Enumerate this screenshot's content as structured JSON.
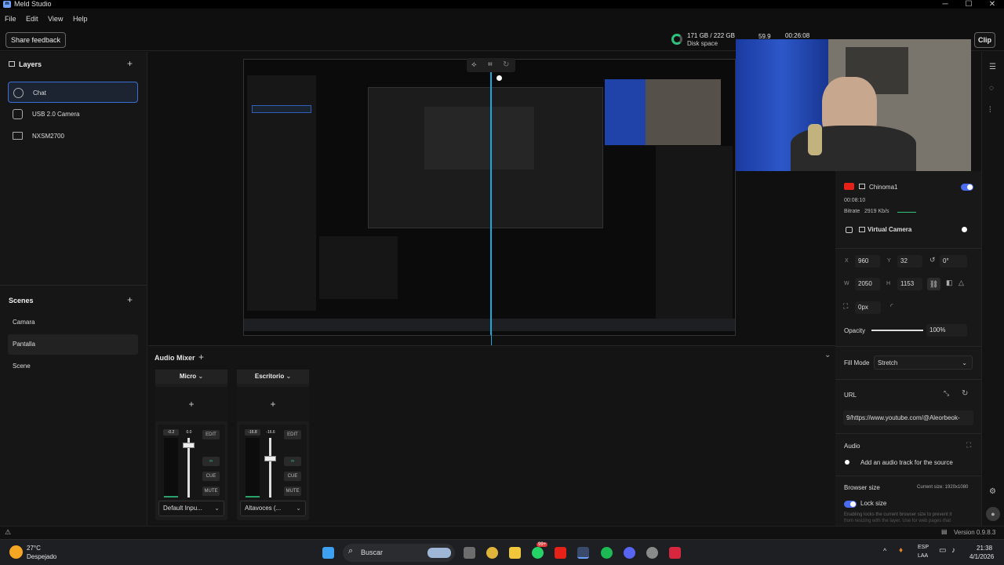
{
  "window": {
    "title": "Meld Studio",
    "logo": "meld-logo",
    "minimize": "─",
    "maximize": "☐",
    "close": "✕"
  },
  "menu": [
    "File",
    "Edit",
    "View",
    "Help"
  ],
  "toolbar": {
    "share_feedback": "Share feedback",
    "disk_space_value": "171 GB / 222 GB",
    "disk_space_label": "Disk space",
    "fps": "59.9",
    "timer": "00:26:08",
    "clip": "Clip"
  },
  "layers": {
    "title": "Layers",
    "add": "+",
    "items": [
      {
        "label": "Chat",
        "icon": "globe-icon"
      },
      {
        "label": "USB 2.0 Camera",
        "icon": "camera-icon"
      },
      {
        "label": "NXSM2700",
        "icon": "monitor-icon"
      }
    ]
  },
  "scenes": {
    "title": "Scenes",
    "add": "+",
    "items": [
      "Camara",
      "Pantalla",
      "Scene"
    ]
  },
  "mixer": {
    "title": "Audio Mixer",
    "add": "+",
    "collapse": "⌄",
    "strips": [
      {
        "name": "Micro",
        "level": "-0.2",
        "volume": "0.0",
        "volume_fraction": 0.88,
        "device": "Default Inpu...",
        "edit": "EDIT",
        "cue": "CUE",
        "mute": "MUTE"
      },
      {
        "name": "Escritorio",
        "level": "-16.8",
        "volume": "-16.6",
        "volume_fraction": 0.66,
        "device": "Altavoces (...",
        "edit": "EDIT",
        "cue": "CUE",
        "mute": "MUTE"
      }
    ]
  },
  "stream": {
    "channel": "Chinoma1",
    "time": "00:08:10",
    "bitrate_label": "Bitrate",
    "bitrate": "2919 Kb/s",
    "virtual_camera": "Virtual Camera"
  },
  "properties": {
    "x_label": "X",
    "x": "960",
    "y_label": "Y",
    "y": "32",
    "rotation": "0°",
    "w_label": "W",
    "w": "2050",
    "h_label": "H",
    "h": "1153",
    "corner": "0px",
    "opacity_label": "Opacity",
    "opacity": "100%",
    "opacity_fraction": 1.0,
    "fill_mode_label": "Fill Mode",
    "fill_mode": "Stretch",
    "url_label": "URL",
    "url": "9/https://www.youtube.com/@Aleorbeok-",
    "audio_label": "Audio",
    "audio_track": "Add an audio track for the source",
    "browser_size_label": "Browser size",
    "current_size": "Current size: 1920x1080",
    "lock_size": "Lock size",
    "lock_note_1": "Enabling locks the current browser size to prevent it",
    "lock_note_2": "from resizing with the layer. Use for web pages that"
  },
  "status": {
    "version": "Version 0.9.8.3"
  },
  "taskbar": {
    "temp": "27°C",
    "weather": "Despejado",
    "search": "Buscar",
    "badge_count": "99+",
    "lang_1": "ESP",
    "lang_2": "LAA",
    "time": "21:38",
    "date": "4/1/2026"
  },
  "colors": {
    "accent": "#4a6cf0",
    "selected_border": "#3b6fd8",
    "youtube": "#e62117",
    "guide": "#19a8e0"
  }
}
